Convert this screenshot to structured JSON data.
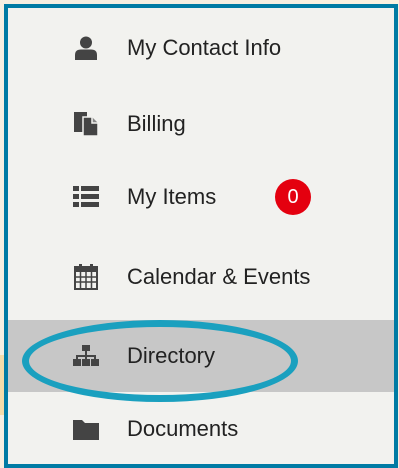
{
  "menu": {
    "items": [
      {
        "label": "My Contact Info",
        "icon": "user-icon"
      },
      {
        "label": "Billing",
        "icon": "billing-documents-icon"
      },
      {
        "label": "My Items",
        "icon": "list-icon",
        "badge": "0"
      },
      {
        "label": "Calendar & Events",
        "icon": "calendar-icon"
      },
      {
        "label": "Directory",
        "icon": "org-chart-icon",
        "active": true
      },
      {
        "label": "Documents",
        "icon": "folder-icon"
      }
    ]
  },
  "colors": {
    "frame_border": "#007ba4",
    "highlight_ellipse": "#1aa0bf",
    "badge": "#e4000f",
    "active_row": "#c7c7c7",
    "icon": "#444444"
  }
}
